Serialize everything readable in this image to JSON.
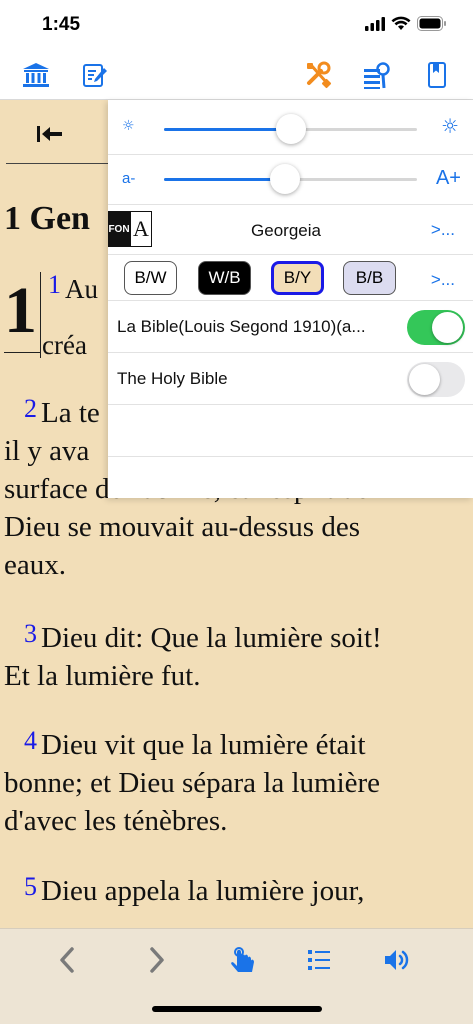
{
  "status": {
    "time": "1:45"
  },
  "toolbar": {
    "icons": [
      "library-icon",
      "notes-icon",
      "tools-icon",
      "search-icon",
      "bookmark-icon"
    ]
  },
  "reader": {
    "book_title": "1 Gen",
    "dropcap": "1",
    "verse1": {
      "num": "1",
      "line1": "Au",
      "line2": "créa"
    },
    "verse2": {
      "num": "2",
      "line1": "La te",
      "line2": "il y ava",
      "line3": "surface de l'abîme, et l'esprit de",
      "line4": "Dieu se mouvait au-dessus des",
      "line5": "eaux."
    },
    "verse3": {
      "num": "3",
      "line1": "Dieu dit: Que la lumière soit!",
      "line2": "Et la lumière fut."
    },
    "verse4": {
      "num": "4",
      "line1": "Dieu vit que la lumière était",
      "line2": "bonne; et Dieu sépara la lumière",
      "line3": "d'avec les ténèbres."
    },
    "verse5": {
      "num": "5",
      "line1": "Dieu appela la lumière jour,"
    }
  },
  "settings": {
    "brightness": {
      "min_icon": "☼",
      "max_icon": "☼",
      "value": 0.5
    },
    "font_size": {
      "min_label": "a-",
      "max_label": "A+",
      "value": 0.48
    },
    "font": {
      "badge_left": "FON",
      "badge_right": "A",
      "name": "Georgeia",
      "more": ">..."
    },
    "themes": [
      {
        "label": "B/W",
        "bg": "#ffffff",
        "fg": "#000000",
        "selected": false
      },
      {
        "label": "W/B",
        "bg": "#000000",
        "fg": "#ffffff",
        "selected": false
      },
      {
        "label": "B/Y",
        "bg": "#f2deb8",
        "fg": "#000000",
        "selected": true
      },
      {
        "label": "B/B",
        "bg": "#dcdcf0",
        "fg": "#000000",
        "selected": false
      }
    ],
    "themes_more": ">...",
    "bibles": [
      {
        "label": "La Bible(Louis Segond 1910)(a...",
        "enabled": true
      },
      {
        "label": "The Holy Bible",
        "enabled": false
      }
    ]
  },
  "bottombar": {
    "icons": [
      "chevron-left-icon",
      "chevron-right-icon",
      "tap-icon",
      "list-icon",
      "speaker-icon"
    ]
  },
  "colors": {
    "accent": "#1a73e8",
    "toolbar_orange": "#f28c1e",
    "page_bg": "#f2deb8",
    "toggle_on": "#34c759",
    "toggle_off": "#e9e9eb"
  }
}
